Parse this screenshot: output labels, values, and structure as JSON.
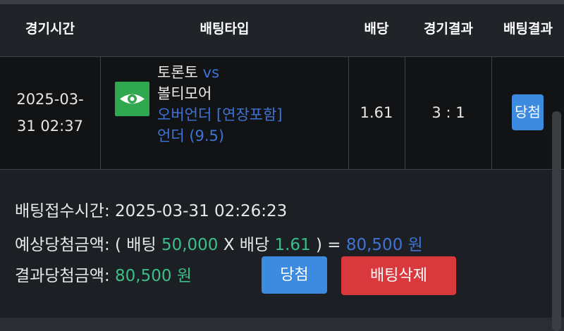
{
  "table": {
    "headers": {
      "game_time": "경기시간",
      "bet_type": "배팅타입",
      "odds": "배당",
      "game_result": "경기결과",
      "bet_result": "배팅결과"
    },
    "row": {
      "date": "2025-03-",
      "time": "31 02:37",
      "home_team": "토론토",
      "vs": "vs",
      "away_team": "볼티모어",
      "market": "오버언더 [연장포함]",
      "pick": "언더 (9.5)",
      "odds": "1.61",
      "score": "3 : 1",
      "result_badge": "당첨"
    }
  },
  "details": {
    "received_label": "배팅접수시간: ",
    "received_time": "2025-03-31 02:26:23",
    "expected_label": "예상당첨금액: ( 배팅 ",
    "bet_amount": "50,000",
    "times_label": " X 배당 ",
    "odds": "1.61",
    "equals": " ) = ",
    "expected_amount": "80,500 원",
    "result_label": "결과당첨금액: ",
    "result_amount": "80,500 원"
  },
  "buttons": {
    "win": "당첨",
    "delete": "배팅삭제"
  },
  "colors": {
    "accent_blue": "#3c8be0",
    "link_blue": "#3f73d6",
    "green": "#3bbf8a",
    "delete_red": "#d9383c",
    "icon_green": "#2fa84f"
  },
  "icons": {
    "bet_type_icon": "eye-icon"
  }
}
